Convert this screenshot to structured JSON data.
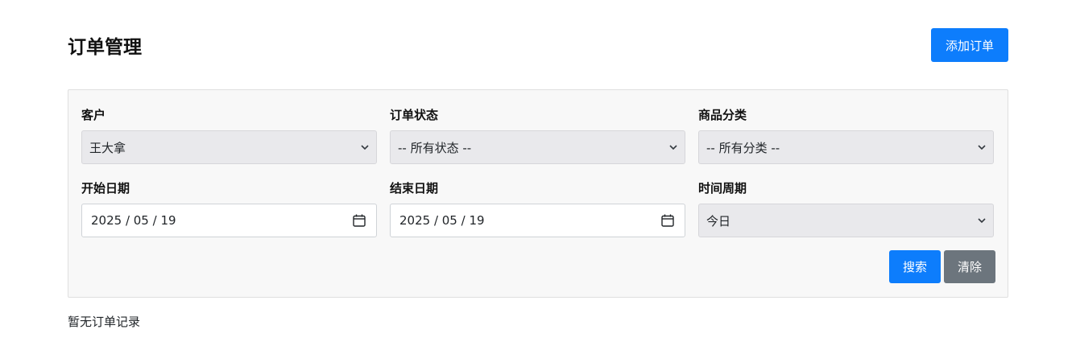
{
  "header": {
    "title": "订单管理",
    "add_button": "添加订单"
  },
  "filters": {
    "customer": {
      "label": "客户",
      "value": "王大拿"
    },
    "status": {
      "label": "订单状态",
      "value": "-- 所有状态 --"
    },
    "category": {
      "label": "商品分类",
      "value": "-- 所有分类 --"
    },
    "start_date": {
      "label": "开始日期",
      "value": "2025 / 05 / 19"
    },
    "end_date": {
      "label": "结束日期",
      "value": "2025 / 05 / 19"
    },
    "period": {
      "label": "时间周期",
      "value": "今日"
    }
  },
  "actions": {
    "search": "搜索",
    "clear": "清除"
  },
  "results": {
    "empty_message": "暂无订单记录"
  },
  "colors": {
    "primary": "#0d7dfc",
    "secondary": "#6c757d",
    "panel_bg": "#f8f8f8"
  },
  "icons": {
    "select_arrow": "chevron-down-icon",
    "date_picker": "calendar-icon"
  }
}
